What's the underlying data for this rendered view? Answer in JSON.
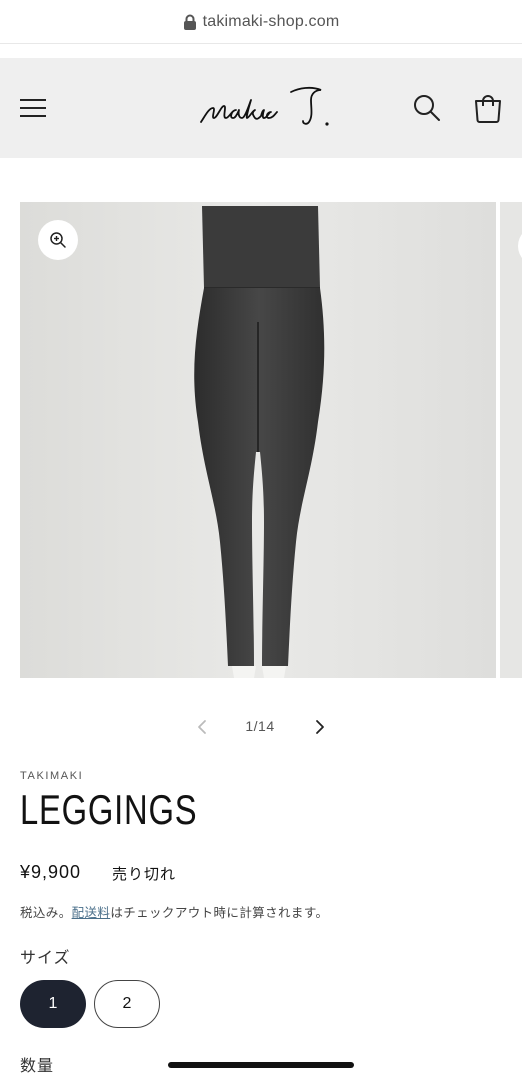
{
  "browser": {
    "url": "takimaki-shop.com"
  },
  "header": {
    "logo_text": "makiko T."
  },
  "gallery": {
    "counter": "1/14"
  },
  "product": {
    "vendor": "TAKIMAKI",
    "title": "LEGGINGS",
    "price": "¥9,900",
    "availability": "売り切れ",
    "tax_prefix": "税込み。",
    "shipping_link": "配送料",
    "tax_suffix": "はチェックアウト時に計算されます。",
    "size_label": "サイズ",
    "sizes": [
      "1",
      "2"
    ],
    "selected_size": "1",
    "quantity_label": "数量"
  },
  "colors": {
    "header_bg": "#efefef",
    "selected_chip": "#1e2330",
    "link": "#4a6f8a"
  }
}
